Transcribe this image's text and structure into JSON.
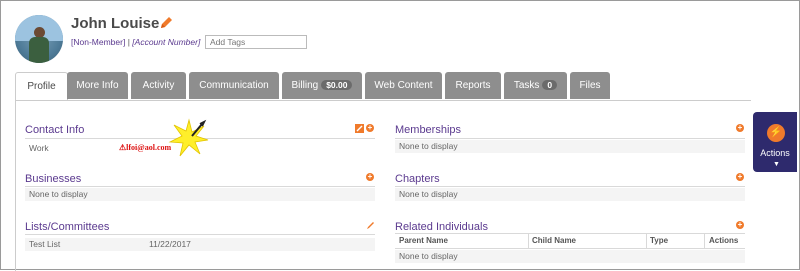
{
  "header": {
    "name": "John Louise",
    "member_status": "[Non-Member]",
    "account_number": "[Account Number]",
    "tags_placeholder": "Add Tags"
  },
  "tabs": [
    {
      "label": "Profile"
    },
    {
      "label": "More Info"
    },
    {
      "label": "Activity"
    },
    {
      "label": "Communication"
    },
    {
      "label": "Billing",
      "badge": "$0.00"
    },
    {
      "label": "Web Content"
    },
    {
      "label": "Reports"
    },
    {
      "label": "Tasks",
      "badge": "0"
    },
    {
      "label": "Files"
    }
  ],
  "left": {
    "contact_info": {
      "title": "Contact Info",
      "row_label": "Work",
      "email_alert": "lfoi@aol.com"
    },
    "businesses": {
      "title": "Businesses",
      "empty": "None to display"
    },
    "lists": {
      "title": "Lists/Committees",
      "row_name": "Test List",
      "row_date": "11/22/2017"
    }
  },
  "right": {
    "memberships": {
      "title": "Memberships",
      "empty": "None to display"
    },
    "chapters": {
      "title": "Chapters",
      "empty": "None to display"
    },
    "related": {
      "title": "Related Individuals",
      "columns": [
        "Parent Name",
        "Child Name",
        "Type",
        "Actions"
      ],
      "empty": "None to display"
    }
  },
  "actions": {
    "label": "Actions"
  },
  "colors": {
    "accent": "#5b3a8f",
    "orange": "#f07a2b",
    "tab_grey": "#8e8e8e",
    "actions_bg": "#2e2a6d"
  }
}
